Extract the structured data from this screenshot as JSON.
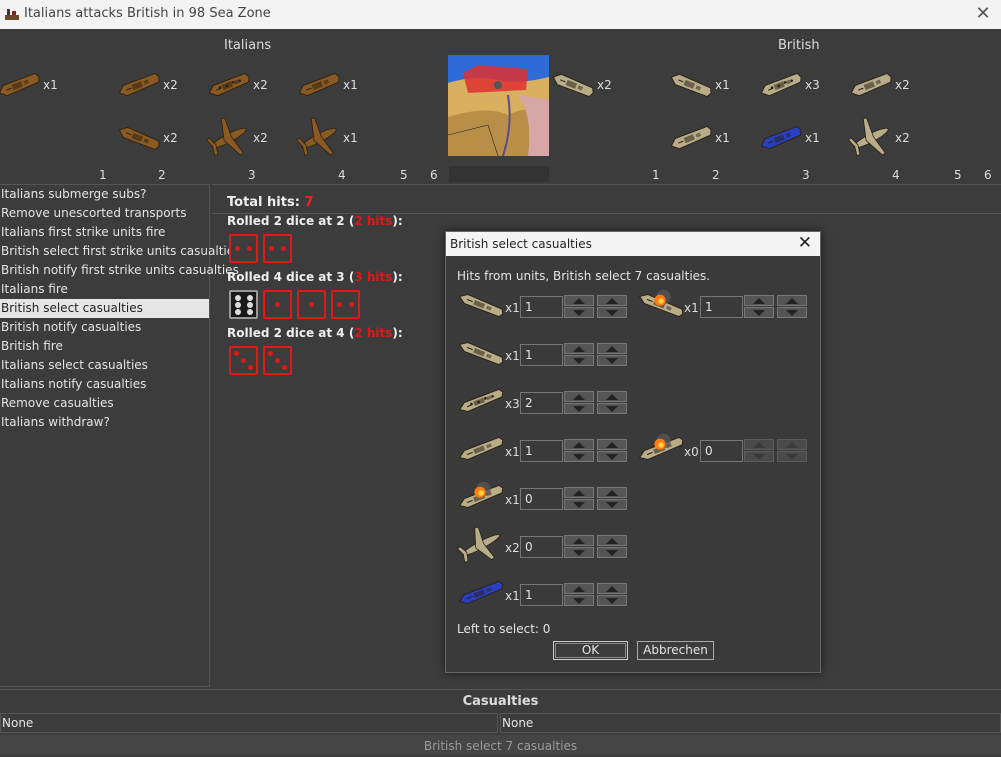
{
  "window": {
    "title": "Italians attacks British in 98 Sea Zone",
    "close": "✕"
  },
  "attacker": {
    "name": "Italians",
    "units": [
      {
        "icon": "battleship-icon",
        "count": "x1"
      },
      {
        "icon": "cruiser-icon",
        "count": "x2"
      },
      {
        "icon": "carrier-icon",
        "count": "x2"
      },
      {
        "icon": "battleship-icon",
        "count": "x1"
      },
      {
        "icon": "destroyer-icon",
        "count": "x2"
      },
      {
        "icon": "fighter-icon",
        "count": "x2"
      },
      {
        "icon": "bomber-icon",
        "count": "x1"
      }
    ],
    "dice_labels": [
      "1",
      "2",
      "3",
      "4",
      "5",
      "6"
    ]
  },
  "defender": {
    "name": "British",
    "units": [
      {
        "icon": "transport-icon",
        "count": "x2"
      },
      {
        "icon": "destroyer-icon",
        "count": "x1"
      },
      {
        "icon": "carrier-icon",
        "count": "x3"
      },
      {
        "icon": "battleship-icon",
        "count": "x2"
      },
      {
        "icon": "cruiser-icon",
        "count": "x1"
      },
      {
        "icon": "submarine-icon",
        "count": "x1"
      },
      {
        "icon": "fighter-icon",
        "count": "x2"
      }
    ],
    "dice_labels": [
      "1",
      "2",
      "3",
      "4",
      "5",
      "6"
    ]
  },
  "steps": [
    {
      "label": "Italians submerge subs?",
      "selected": false
    },
    {
      "label": "Remove unescorted transports",
      "selected": false
    },
    {
      "label": "Italians first strike units fire",
      "selected": false
    },
    {
      "label": "British select first strike units casualties",
      "selected": false
    },
    {
      "label": "British notify first strike units casualties",
      "selected": false
    },
    {
      "label": "Italians fire",
      "selected": false
    },
    {
      "label": "British select casualties",
      "selected": true
    },
    {
      "label": "British notify casualties",
      "selected": false
    },
    {
      "label": "British fire",
      "selected": false
    },
    {
      "label": "Italians select casualties",
      "selected": false
    },
    {
      "label": "Italians notify casualties",
      "selected": false
    },
    {
      "label": "Remove casualties",
      "selected": false
    },
    {
      "label": "Italians withdraw?",
      "selected": false
    }
  ],
  "hits": {
    "total_label": "Total hits:",
    "total_value": "7",
    "rolls": [
      {
        "prefix": "Rolled 2 dice at 2 (",
        "hits": "2 hits",
        "suffix": "):",
        "dice": [
          2,
          2
        ]
      },
      {
        "prefix": "Rolled 4 dice at 3 (",
        "hits": "3 hits",
        "suffix": "):",
        "dice": [
          6,
          1,
          1,
          2
        ]
      },
      {
        "prefix": "Rolled 2 dice at 4 (",
        "hits": "2 hits",
        "suffix": "):",
        "dice": [
          3,
          3
        ]
      }
    ]
  },
  "dialog": {
    "title": "British select casualties",
    "close": "✕",
    "message": "Hits from units,  British select 7 casualties.",
    "rows": [
      {
        "icon": "transport-icon",
        "count": "x1",
        "value": "1",
        "damaged_icon": "damaged-transport-icon",
        "damaged_count": "x1",
        "damaged_value": "1"
      },
      {
        "icon": "destroyer-icon",
        "count": "x1",
        "value": "1"
      },
      {
        "icon": "carrier-icon",
        "count": "x3",
        "value": "2"
      },
      {
        "icon": "battleship-icon",
        "count": "x1",
        "value": "1",
        "damaged_icon": "damaged-battleship-icon",
        "damaged_count": "x0",
        "damaged_value": "0"
      },
      {
        "icon": "damaged-battleship-icon",
        "count": "x1",
        "value": "0"
      },
      {
        "icon": "fighter-icon",
        "count": "x2",
        "value": "0"
      },
      {
        "icon": "submarine-icon",
        "count": "x1",
        "value": "1"
      }
    ],
    "left_to_select": "Left to select: 0",
    "ok": "OK",
    "cancel": "Abbrechen"
  },
  "casualties": {
    "title": "Casualties",
    "attacker_value": "None",
    "defender_value": "None"
  },
  "status": "British select 7 casualties",
  "colors": {
    "italian_unit": "#8a5a22",
    "british_unit": "#b8ad88",
    "british_sub": "#2a3fc0",
    "hit_red": "#e01818"
  }
}
